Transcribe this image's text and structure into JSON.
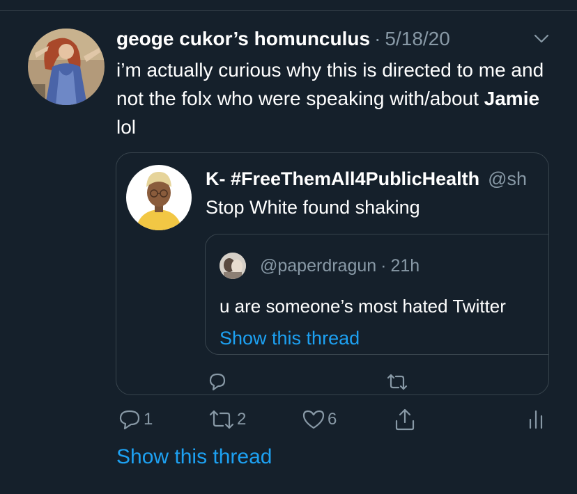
{
  "tweet": {
    "author_name": "geoge cukor’s homunculus",
    "separator": "·",
    "date": "5/18/20",
    "text_before": "i’m actually curious why this is directed to me and not the folx who were speaking with/about ",
    "text_bold": "Jamie",
    "text_after": " lol",
    "icons": {
      "menu": "chevron-down-icon",
      "avatar": "painting-avatar"
    }
  },
  "quoted_tweet": {
    "name": "K- #FreeThemAll4PublicHealth",
    "handle": "@sh",
    "text": "Stop White found shaking",
    "nested": {
      "handle": "@paperdragun",
      "separator": "·",
      "time": "21h",
      "text": "u are someone’s most hated Twitter",
      "show_thread": "Show this thread"
    },
    "actions": [
      {
        "icon": "reply-icon"
      },
      {
        "icon": "retweet-icon"
      }
    ]
  },
  "actions": {
    "reply": {
      "icon": "reply-icon",
      "count": "1"
    },
    "retweet": {
      "icon": "retweet-icon",
      "count": "2"
    },
    "like": {
      "icon": "heart-icon",
      "count": "6"
    },
    "share": {
      "icon": "share-icon"
    },
    "analytics": {
      "icon": "analytics-icon"
    }
  },
  "show_thread": "Show this thread",
  "colors": {
    "background": "#15202b",
    "text": "#ffffff",
    "secondary": "#8899a6",
    "accent": "#1da1f2",
    "border": "#38444d"
  }
}
